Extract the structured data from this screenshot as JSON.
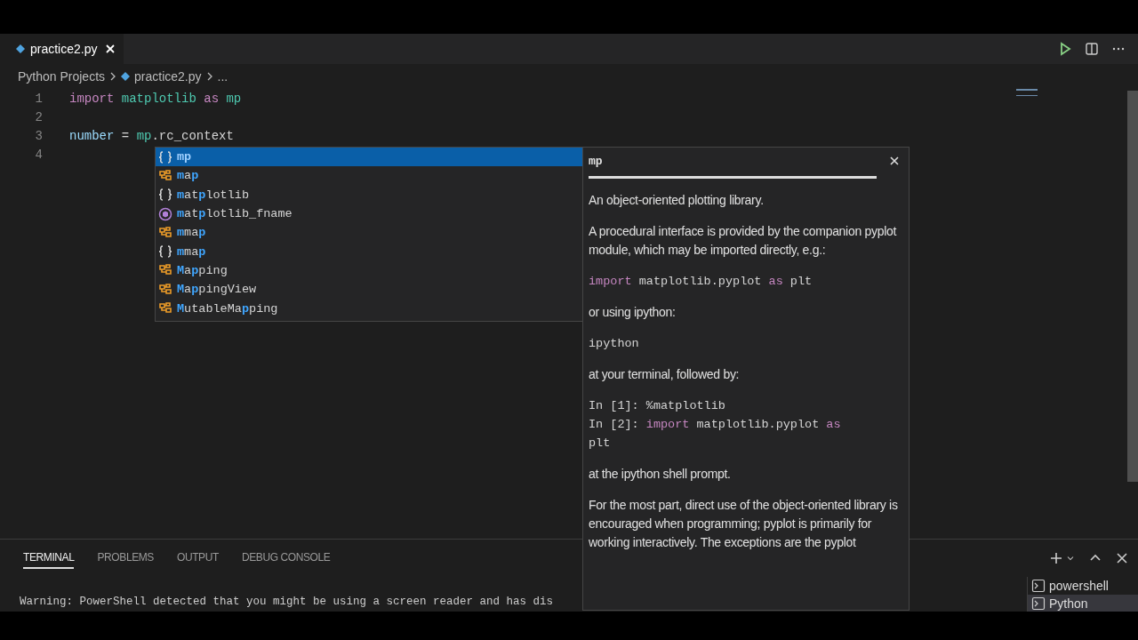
{
  "tabs": [
    {
      "label": "practice2.py",
      "selected": true
    }
  ],
  "breadcrumb": {
    "folder": "Python Projects",
    "file": "practice2.py",
    "more": "..."
  },
  "editor": {
    "lines": [
      {
        "number": "1",
        "tokens": [
          {
            "kind": "keyword",
            "text": "import "
          },
          {
            "kind": "module",
            "text": "matplotlib "
          },
          {
            "kind": "keyword",
            "text": "as "
          },
          {
            "kind": "module",
            "text": "mp"
          }
        ]
      },
      {
        "number": "2"
      },
      {
        "number": "3",
        "tokens": [
          {
            "kind": "variable",
            "text": "number"
          },
          {
            "kind": "plain",
            "text": " = "
          },
          {
            "kind": "module",
            "text": "mp"
          },
          {
            "kind": "plain",
            "text": ".rc_context"
          }
        ]
      },
      {
        "number": "4"
      }
    ]
  },
  "suggestions": [
    {
      "kind": "module",
      "label": "**mp**",
      "selected": true
    },
    {
      "kind": "class",
      "label": "**m**a**p**",
      "selected": false
    },
    {
      "kind": "module",
      "label": "**m**at**p**lotlib",
      "selected": false
    },
    {
      "kind": "function",
      "label": "**m**at**p**lotlib_fname",
      "selected": false
    },
    {
      "kind": "class",
      "label": "**m**ma**p**",
      "selected": false
    },
    {
      "kind": "module",
      "label": "**m**ma**p**",
      "selected": false
    },
    {
      "kind": "class",
      "label": "**M**a**p**ping",
      "selected": false
    },
    {
      "kind": "class",
      "label": "**M**a**p**pingView",
      "selected": false
    },
    {
      "kind": "class",
      "label": "**M**utableMa**p**ping",
      "selected": false
    }
  ],
  "hover": {
    "title": "mp",
    "blocks": [
      {
        "kind": "text",
        "text": "An object-oriented plotting library."
      },
      {
        "kind": "text",
        "text": "A procedural interface is provided by the companion pyplot module, which may be imported directly, e.g.:"
      },
      {
        "kind": "code",
        "lines": [
          [
            {
              "kind": "keyword",
              "text": "import"
            },
            {
              "kind": "plain",
              "text": " matplotlib.pyplot "
            },
            {
              "kind": "keyword",
              "text": "as"
            },
            {
              "kind": "plain",
              "text": " plt"
            }
          ]
        ]
      },
      {
        "kind": "text",
        "text": "or using ipython:"
      },
      {
        "kind": "code",
        "lines": [
          [
            {
              "kind": "plain",
              "text": "ipython"
            }
          ]
        ]
      },
      {
        "kind": "text",
        "text": "at your terminal, followed by:"
      },
      {
        "kind": "code",
        "lines": [
          [
            {
              "kind": "plain",
              "text": "In [1]: %matplotlib"
            }
          ],
          [
            {
              "kind": "plain",
              "text": "In [2]: "
            },
            {
              "kind": "keyword",
              "text": "import"
            },
            {
              "kind": "plain",
              "text": " matplotlib.pyplot "
            },
            {
              "kind": "keyword",
              "text": "as"
            }
          ],
          [
            {
              "kind": "plain",
              "text": "plt"
            }
          ]
        ]
      },
      {
        "kind": "text",
        "text": "at the ipython shell prompt."
      },
      {
        "kind": "text",
        "text": "For the most part, direct use of the object-oriented library is encouraged when programming; pyplot is primarily for working interactively. The exceptions are the pyplot"
      }
    ]
  },
  "panel": {
    "tabs": [
      {
        "label": "TERMINAL",
        "selected": true
      },
      {
        "label": "PROBLEMS",
        "selected": false
      },
      {
        "label": "OUTPUT",
        "selected": false
      },
      {
        "label": "DEBUG CONSOLE",
        "selected": false
      }
    ],
    "terminal_line": "Warning: PowerShell detected that you might be using a screen reader and has dis",
    "terminals": [
      {
        "label": "powershell",
        "selected": false
      },
      {
        "label": "Python",
        "selected": true
      }
    ]
  }
}
